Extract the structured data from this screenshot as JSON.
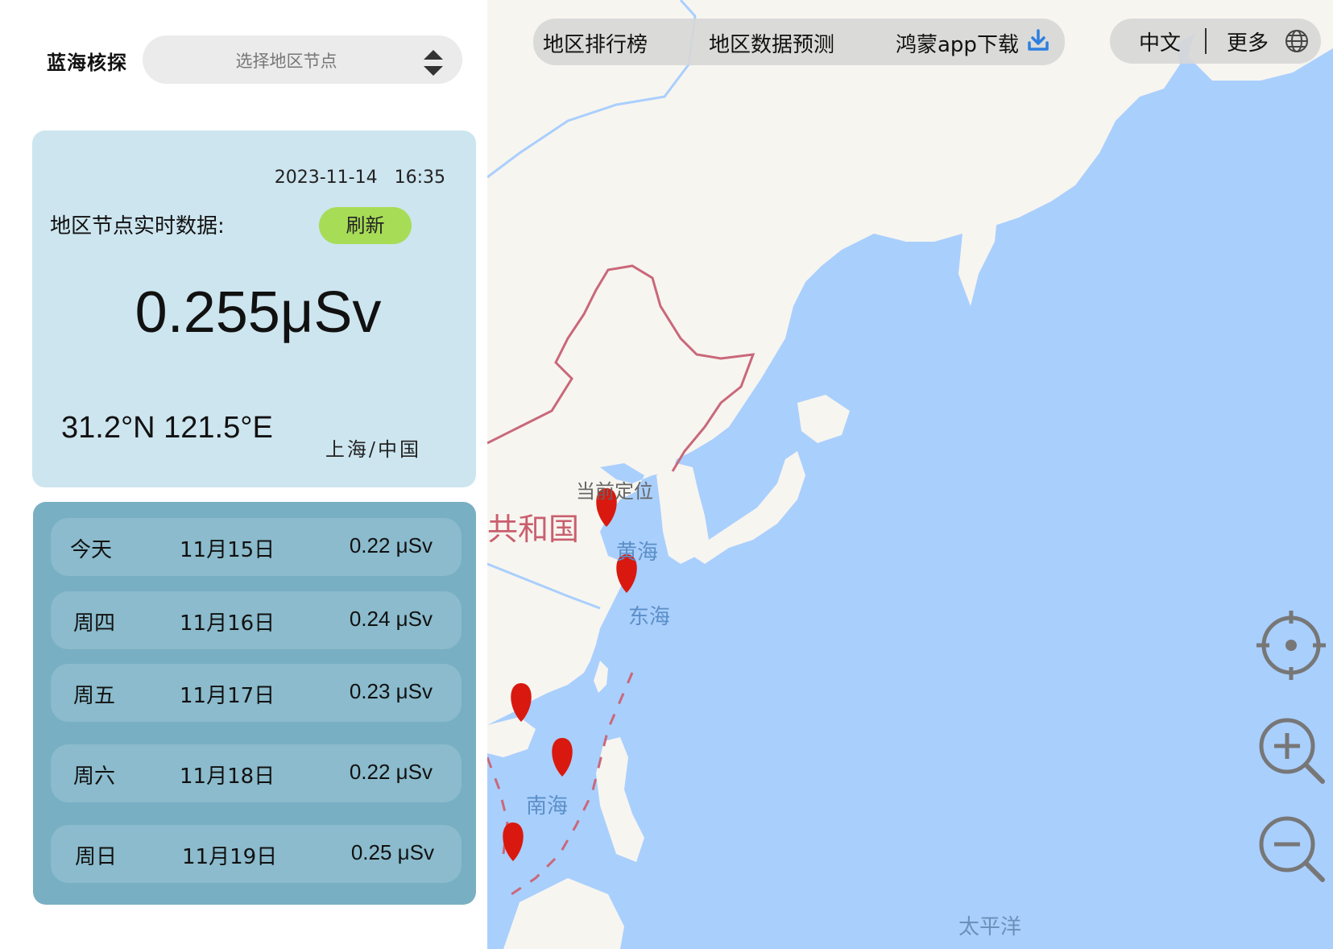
{
  "app": {
    "title": "蓝海核探"
  },
  "region_select": {
    "placeholder": "选择地区节点"
  },
  "realtime": {
    "datetime": "2023-11-14 16:35",
    "label": "地区节点实时数据:",
    "refresh_label": "刷新",
    "dose": "0.255μSv",
    "coords": "31.2°N 121.5°E",
    "location": "上海/中国"
  },
  "forecast": [
    {
      "day": "今天",
      "date": "11月15日",
      "value": "0.22 μSv"
    },
    {
      "day": "周四",
      "date": "11月16日",
      "value": "0.24 μSv"
    },
    {
      "day": "周五",
      "date": "11月17日",
      "value": "0.23 μSv"
    },
    {
      "day": "周六",
      "date": "11月18日",
      "value": "0.22 μSv"
    },
    {
      "day": "周日",
      "date": "11月19日",
      "value": "0.25 μSv"
    }
  ],
  "nav": {
    "ranking": "地区排行榜",
    "prediction": "地区数据预测",
    "download": "鸿蒙app下载",
    "download_icon": "download-icon",
    "language": "中文",
    "more": "更多",
    "globe_icon": "globe-icon"
  },
  "map": {
    "current_location": "当前定位",
    "country_partial": "共和国",
    "yellow_sea": "黄海",
    "east_sea": "东海",
    "south_sea": "南海",
    "pacific": "太平洋",
    "marker_color": "#d9190f",
    "land_color": "#f7f5f0",
    "water_color": "#a9cffd"
  },
  "controls": {
    "locate_icon": "locate-icon",
    "zoom_in_icon": "zoom-in-icon",
    "zoom_out_icon": "zoom-out-icon"
  }
}
